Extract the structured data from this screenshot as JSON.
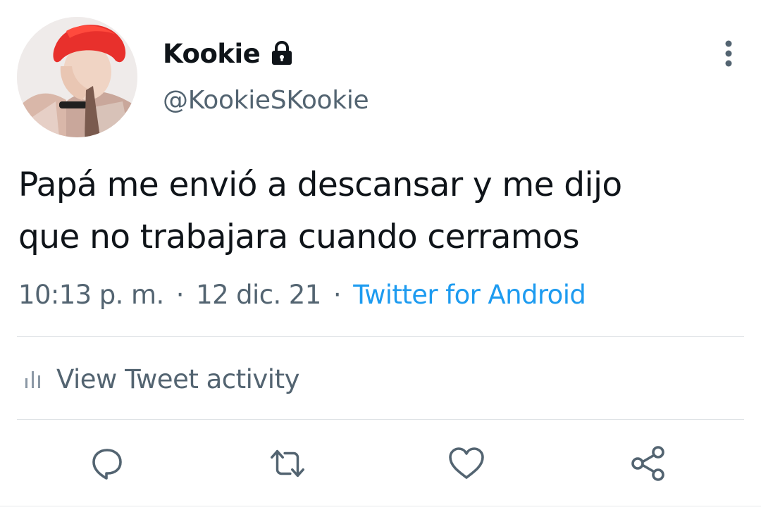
{
  "author": {
    "display_name": "Kookie",
    "handle": "@KookieSKookie",
    "protected_icon": "lock-icon",
    "avatar": "profile-photo"
  },
  "tweet": {
    "text_lines": [
      "Papá me envió a descansar y me dijo",
      "que no trabajara cuando cerramos"
    ],
    "time": "10:13 p. m.",
    "separator": "·",
    "date": "12 dic. 21",
    "source": "Twitter for Android"
  },
  "activity": {
    "label": "View Tweet activity",
    "icon": "bar-chart-icon"
  },
  "actions": [
    {
      "name": "reply",
      "icon": "reply-icon"
    },
    {
      "name": "retweet",
      "icon": "retweet-icon"
    },
    {
      "name": "like",
      "icon": "heart-icon"
    },
    {
      "name": "share",
      "icon": "share-icon"
    }
  ],
  "colors": {
    "text_primary": "#0f1419",
    "text_secondary": "#536471",
    "link": "#1d9bf0",
    "icon": "#536471",
    "divider": "#dfe3e6"
  }
}
